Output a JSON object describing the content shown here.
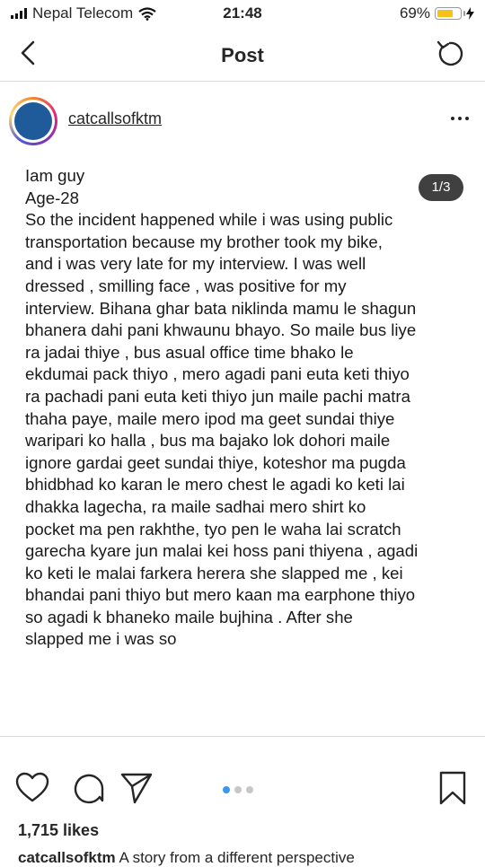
{
  "status_bar": {
    "carrier": "Nepal Telecom",
    "time": "21:48",
    "battery_percent": "69%",
    "battery_level": 0.69,
    "battery_color": "#f4c21b"
  },
  "nav": {
    "back_icon": "chevron-left-icon",
    "title": "Post",
    "refresh_icon": "refresh-icon"
  },
  "post": {
    "username": "catcallsofktm",
    "more_icon": "more-horizontal-icon",
    "counter": "1/3",
    "lines": [
      "Iam guy",
      "Age-28",
      "So the incident happened while i was using public",
      "transportation because my brother took my bike,",
      "and i was very late for my interview. I was well",
      "dressed , smilling face , was positive for my",
      "interview. Bihana ghar bata niklinda mamu le shagun",
      "bhanera dahi pani khwaunu bhayo. So maile bus liye",
      "ra jadai thiye , bus asual office time bhako le",
      "ekdumai pack thiyo , mero agadi pani euta keti thiyo",
      "ra pachadi pani euta keti thiyo jun maile pachi matra",
      "thaha paye, maile mero ipod ma geet sundai thiye",
      "waripari ko halla , bus ma bajako lok dohori maile",
      "ignore gardai geet sundai thiye, koteshor ma pugda",
      "bhidbhad ko karan le mero chest le agadi ko keti lai",
      "dhakka lagecha, ra maile sadhai mero shirt ko",
      "pocket ma pen rakhthe, tyo pen le waha lai scratch",
      "garecha kyare jun malai kei hoss pani thiyena , agadi",
      "ko keti le malai farkera herera she slapped me , kei",
      "bhandai pani thiyo but mero kaan ma earphone thiyo",
      "so agadi k bhaneko maile bujhina . After she",
      "slapped me i was so"
    ]
  },
  "actions": {
    "like_icon": "heart-icon",
    "comment_icon": "comment-icon",
    "share_icon": "send-icon",
    "save_icon": "bookmark-icon",
    "carousel_active_color": "#3897f0"
  },
  "likes": "1,715 likes",
  "caption": {
    "username": "catcallsofktm",
    "text": " A story from a different perspective"
  }
}
